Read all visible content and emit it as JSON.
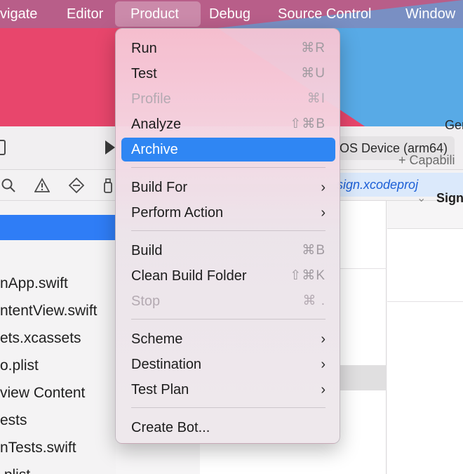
{
  "menubar": {
    "items": [
      "vigate",
      "Editor",
      "Product",
      "Debug",
      "Source Control",
      "Window"
    ],
    "active": "Product"
  },
  "toolbar": {
    "device": "OS Device (arm64)"
  },
  "navigator": {
    "path": "sign.xcodeproj",
    "icons": [
      "magnifier-icon",
      "warning-icon",
      "diamond-icon",
      "spray-icon"
    ]
  },
  "sidebar": {
    "files": [
      "nApp.swift",
      "ntentView.swift",
      "ets.xcassets",
      "o.plist",
      "view Content",
      "ests",
      "nTests.swift",
      ".plist"
    ]
  },
  "editor": {
    "tab_label": "Ger",
    "capability_label": "+ Capabili",
    "section_label": "Sign"
  },
  "menu": {
    "items": [
      {
        "label": "Run",
        "shortcut": "⌘R",
        "disabled": false
      },
      {
        "label": "Test",
        "shortcut": "⌘U",
        "disabled": false
      },
      {
        "label": "Profile",
        "shortcut": "⌘I",
        "disabled": true
      },
      {
        "label": "Analyze",
        "shortcut": "⇧⌘B",
        "disabled": false
      },
      {
        "label": "Archive",
        "shortcut": "",
        "highlighted": true
      },
      {
        "label": "Build For",
        "submenu": true
      },
      {
        "label": "Perform Action",
        "submenu": true
      },
      {
        "label": "Build",
        "shortcut": "⌘B",
        "disabled": false
      },
      {
        "label": "Clean Build Folder",
        "shortcut": "⇧⌘K",
        "disabled": false
      },
      {
        "label": "Stop",
        "shortcut": "⌘ .",
        "disabled": true
      },
      {
        "label": "Scheme",
        "submenu": true
      },
      {
        "label": "Destination",
        "submenu": true
      },
      {
        "label": "Test Plan",
        "submenu": true
      },
      {
        "label": "Create Bot...",
        "shortcut": ""
      }
    ],
    "submenu_glyph": "›"
  }
}
